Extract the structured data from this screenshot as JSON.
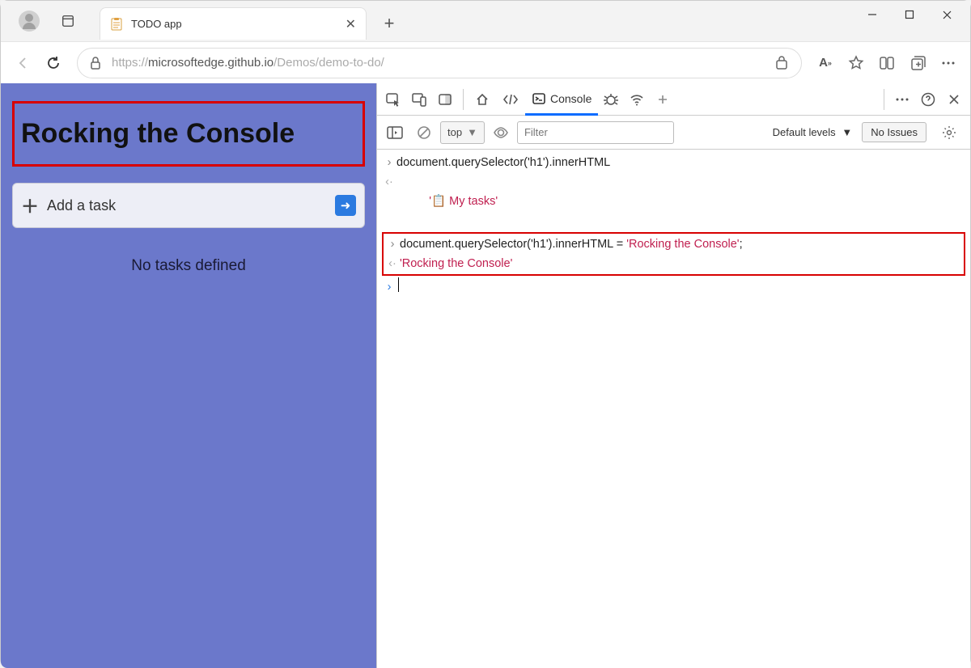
{
  "window": {
    "tab_title": "TODO app",
    "url_prefix": "https://",
    "url_host": "microsoftedge.github.io",
    "url_path": "/Demos/demo-to-do/"
  },
  "page": {
    "heading": "Rocking the Console",
    "add_placeholder": "Add a task",
    "empty_text": "No tasks defined"
  },
  "devtools": {
    "tab_console": "Console",
    "context": "top",
    "filter_placeholder": "Filter",
    "levels_label": "Default levels",
    "issues_label": "No Issues"
  },
  "console": {
    "line1": "document.querySelector('h1').innerHTML",
    "ret1_prefix": "'📋 ",
    "ret1_text": "My tasks",
    "ret1_suffix": "'",
    "line2_a": "document.querySelector('h1').innerHTML = ",
    "line2_b": "'Rocking the Console'",
    "line2_c": ";",
    "ret2": "'Rocking the Console'"
  }
}
